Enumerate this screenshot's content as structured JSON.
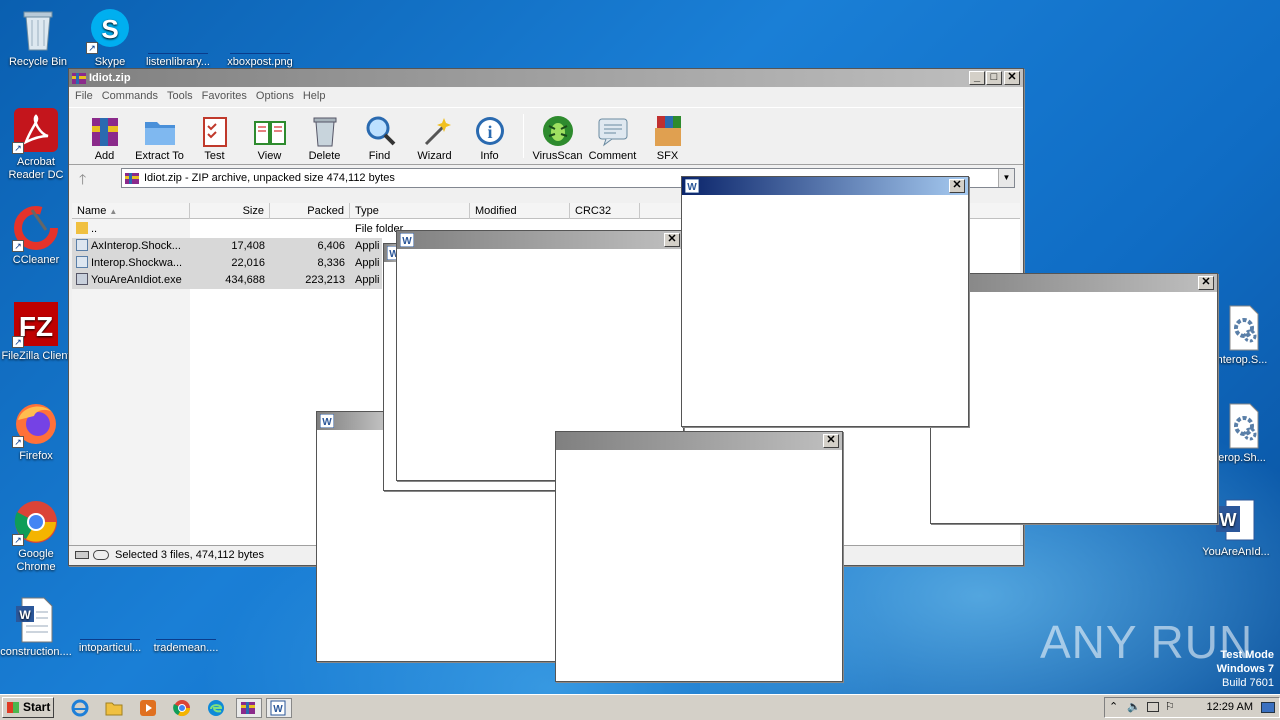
{
  "desktop": {
    "icons": [
      {
        "label": "Recycle Bin"
      },
      {
        "label": "Skype"
      },
      {
        "label": "listenlibrary..."
      },
      {
        "label": "xboxpost.png"
      },
      {
        "label": "Acrobat Reader DC"
      },
      {
        "label": "CCleaner"
      },
      {
        "label": "FileZilla Client"
      },
      {
        "label": "Firefox"
      },
      {
        "label": "Google Chrome"
      },
      {
        "label": "construction...."
      },
      {
        "label": "intoparticul..."
      },
      {
        "label": "trademean...."
      },
      {
        "label": "nterop.S..."
      },
      {
        "label": "erop.Sh..."
      },
      {
        "label": "YouAreAnId..."
      }
    ]
  },
  "winrar": {
    "title": "Idiot.zip",
    "menu": [
      "File",
      "Commands",
      "Tools",
      "Favorites",
      "Options",
      "Help"
    ],
    "toolbar": [
      "Add",
      "Extract To",
      "Test",
      "View",
      "Delete",
      "Find",
      "Wizard",
      "Info",
      "VirusScan",
      "Comment",
      "SFX"
    ],
    "address": "Idiot.zip - ZIP archive, unpacked size 474,112 bytes",
    "columns": [
      "Name",
      "Size",
      "Packed",
      "Type",
      "Modified",
      "CRC32"
    ],
    "files": [
      {
        "name": "..",
        "size": "",
        "packed": "",
        "type": "File folder"
      },
      {
        "name": "AxInterop.Shock...",
        "size": "17,408",
        "packed": "6,406",
        "type": "Appli"
      },
      {
        "name": "Interop.Shockwa...",
        "size": "22,016",
        "packed": "8,336",
        "type": "Appli"
      },
      {
        "name": "YouAreAnIdiot.exe",
        "size": "434,688",
        "packed": "223,213",
        "type": "Appli"
      }
    ],
    "status": "Selected 3 files, 474,112 bytes"
  },
  "taskbar": {
    "start": "Start",
    "clock": "12:29 AM"
  },
  "watermark": "ANY RUN",
  "testmode": {
    "line1": "Test Mode",
    "line2": "Windows 7",
    "line3": "Build 7601"
  },
  "colors": {
    "active_title": "#0a246a",
    "inactive_title": "#808080",
    "desktop": "#1a7fd6"
  }
}
